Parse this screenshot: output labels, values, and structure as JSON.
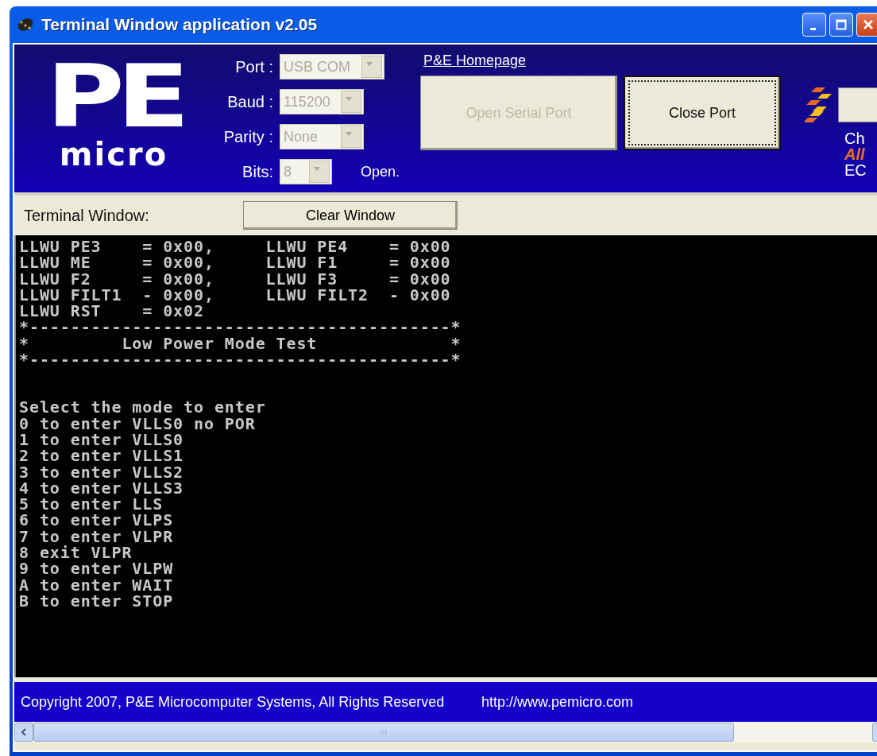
{
  "window": {
    "title": "Terminal Window application v2.05"
  },
  "logo": {
    "letters": "PE",
    "word": "micro"
  },
  "settings": [
    {
      "label": "Port :",
      "value": "USB COM",
      "disabled": true
    },
    {
      "label": "Baud :",
      "value": "115200",
      "disabled": true
    },
    {
      "label": "Parity :",
      "value": "None",
      "disabled": true
    },
    {
      "label": "Bits:",
      "value": "8",
      "disabled": true
    }
  ],
  "port_status": "Open.",
  "homepage_link": "P&E Homepage",
  "buttons": [
    {
      "label": "Open Serial Port",
      "disabled": true,
      "focused": false
    },
    {
      "label": "Close Port",
      "disabled": false,
      "focused": true
    }
  ],
  "side_logo": {
    "texts": [
      {
        "text": "Ch",
        "kind": "plain"
      },
      {
        "text": "All",
        "kind": "accent"
      },
      {
        "text": "EC",
        "kind": "plain"
      }
    ]
  },
  "terminal_bar": {
    "label": "Terminal Window:",
    "clear_button": "Clear Window"
  },
  "terminal_lines": [
    "LLWU PE3    = 0x00,     LLWU PE4    = 0x00",
    "LLWU ME     = 0x00,     LLWU F1     = 0x00",
    "LLWU F2     = 0x00,     LLWU F3     = 0x00",
    "LLWU FILT1  - 0x00,     LLWU FILT2  - 0x00",
    "LLWU RST    = 0x02",
    "*-----------------------------------------*",
    "*         Low Power Mode Test             *",
    "*-----------------------------------------*",
    "Select the mode to enter",
    "0 to enter VLLS0 no POR",
    "1 to enter VLLS0",
    "2 to enter VLLS1",
    "3 to enter VLLS2",
    "4 to enter VLLS3",
    "5 to enter LLS",
    "6 to enter VLPS",
    "7 to enter VLPR",
    "8 exit VLPR",
    "9 to enter VLPW",
    "A to enter WAIT",
    "B to enter STOP"
  ],
  "footer": {
    "copyright": "Copyright 2007, P&E Microcomputer Systems, All Rights Reserved",
    "url": "http://www.pemicro.com"
  }
}
